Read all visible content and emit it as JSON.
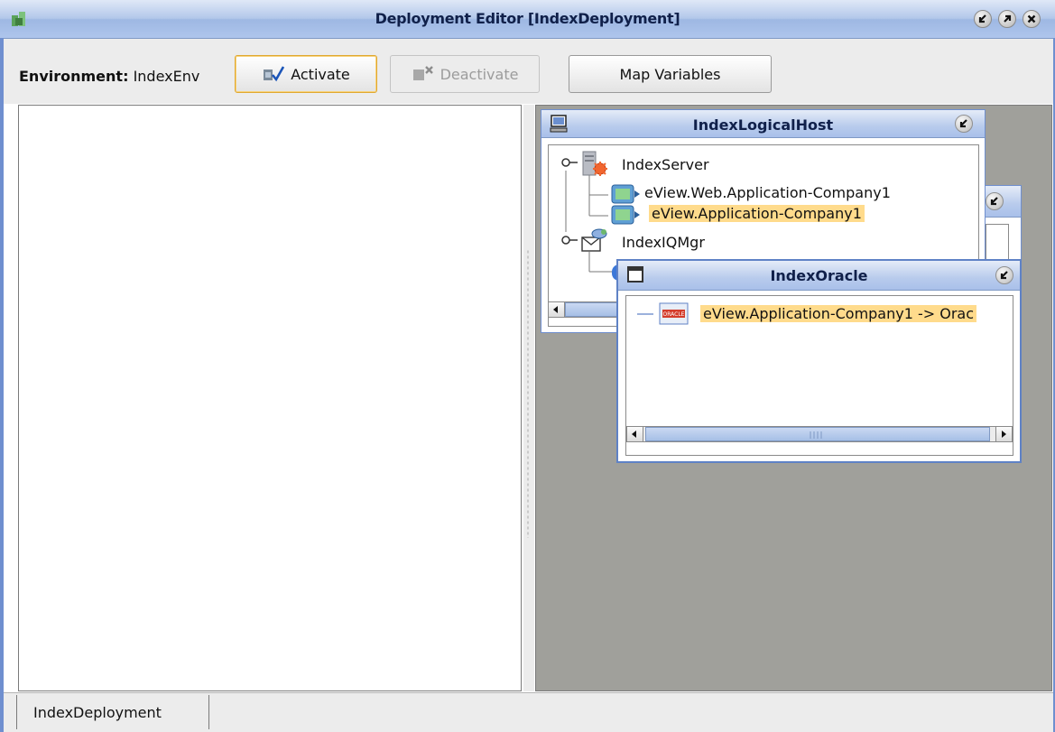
{
  "window": {
    "title": "Deployment Editor [IndexDeployment]"
  },
  "toolbar": {
    "environment_label": "Environment:",
    "environment_value": "IndexEnv",
    "activate_label": "Activate",
    "deactivate_label": "Deactivate",
    "map_variables_label": "Map Variables"
  },
  "logical_host": {
    "title": "IndexLogicalHost",
    "tree": [
      {
        "label": "IndexServer",
        "icon": "server-icon"
      },
      {
        "label": "eView.Web.Application-Company1",
        "icon": "application-icon"
      },
      {
        "label": "eView.Application-Company1",
        "icon": "application-icon",
        "highlighted": true
      },
      {
        "label": "IndexIQMgr",
        "icon": "message-queue-icon"
      }
    ]
  },
  "oracle": {
    "title": "IndexOracle",
    "tree": [
      {
        "label": "eView.Application-Company1 -> Orac",
        "icon": "oracle-db-icon",
        "highlighted": true
      }
    ]
  },
  "bottom_tabs": [
    "IndexDeployment"
  ],
  "colors": {
    "title_bar": "#b3c8ea",
    "highlight": "#ffdb8c",
    "canvas": "#a0a09b",
    "activate_border": "#e0a830"
  }
}
